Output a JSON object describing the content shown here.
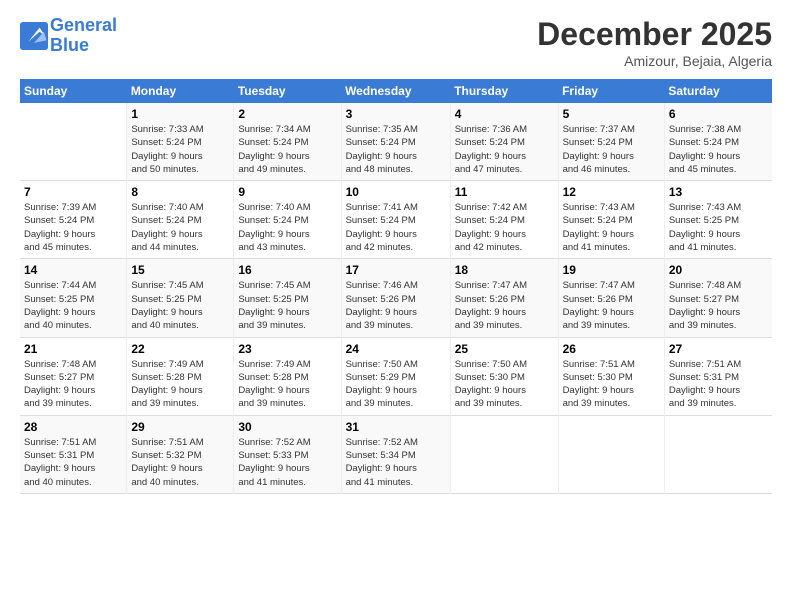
{
  "logo": {
    "line1": "General",
    "line2": "Blue"
  },
  "title": "December 2025",
  "subtitle": "Amizour, Bejaia, Algeria",
  "days_header": [
    "Sunday",
    "Monday",
    "Tuesday",
    "Wednesday",
    "Thursday",
    "Friday",
    "Saturday"
  ],
  "weeks": [
    [
      {
        "day": "",
        "info": ""
      },
      {
        "day": "1",
        "info": "Sunrise: 7:33 AM\nSunset: 5:24 PM\nDaylight: 9 hours\nand 50 minutes."
      },
      {
        "day": "2",
        "info": "Sunrise: 7:34 AM\nSunset: 5:24 PM\nDaylight: 9 hours\nand 49 minutes."
      },
      {
        "day": "3",
        "info": "Sunrise: 7:35 AM\nSunset: 5:24 PM\nDaylight: 9 hours\nand 48 minutes."
      },
      {
        "day": "4",
        "info": "Sunrise: 7:36 AM\nSunset: 5:24 PM\nDaylight: 9 hours\nand 47 minutes."
      },
      {
        "day": "5",
        "info": "Sunrise: 7:37 AM\nSunset: 5:24 PM\nDaylight: 9 hours\nand 46 minutes."
      },
      {
        "day": "6",
        "info": "Sunrise: 7:38 AM\nSunset: 5:24 PM\nDaylight: 9 hours\nand 45 minutes."
      }
    ],
    [
      {
        "day": "7",
        "info": "Sunrise: 7:39 AM\nSunset: 5:24 PM\nDaylight: 9 hours\nand 45 minutes."
      },
      {
        "day": "8",
        "info": "Sunrise: 7:40 AM\nSunset: 5:24 PM\nDaylight: 9 hours\nand 44 minutes."
      },
      {
        "day": "9",
        "info": "Sunrise: 7:40 AM\nSunset: 5:24 PM\nDaylight: 9 hours\nand 43 minutes."
      },
      {
        "day": "10",
        "info": "Sunrise: 7:41 AM\nSunset: 5:24 PM\nDaylight: 9 hours\nand 42 minutes."
      },
      {
        "day": "11",
        "info": "Sunrise: 7:42 AM\nSunset: 5:24 PM\nDaylight: 9 hours\nand 42 minutes."
      },
      {
        "day": "12",
        "info": "Sunrise: 7:43 AM\nSunset: 5:24 PM\nDaylight: 9 hours\nand 41 minutes."
      },
      {
        "day": "13",
        "info": "Sunrise: 7:43 AM\nSunset: 5:25 PM\nDaylight: 9 hours\nand 41 minutes."
      }
    ],
    [
      {
        "day": "14",
        "info": "Sunrise: 7:44 AM\nSunset: 5:25 PM\nDaylight: 9 hours\nand 40 minutes."
      },
      {
        "day": "15",
        "info": "Sunrise: 7:45 AM\nSunset: 5:25 PM\nDaylight: 9 hours\nand 40 minutes."
      },
      {
        "day": "16",
        "info": "Sunrise: 7:45 AM\nSunset: 5:25 PM\nDaylight: 9 hours\nand 39 minutes."
      },
      {
        "day": "17",
        "info": "Sunrise: 7:46 AM\nSunset: 5:26 PM\nDaylight: 9 hours\nand 39 minutes."
      },
      {
        "day": "18",
        "info": "Sunrise: 7:47 AM\nSunset: 5:26 PM\nDaylight: 9 hours\nand 39 minutes."
      },
      {
        "day": "19",
        "info": "Sunrise: 7:47 AM\nSunset: 5:26 PM\nDaylight: 9 hours\nand 39 minutes."
      },
      {
        "day": "20",
        "info": "Sunrise: 7:48 AM\nSunset: 5:27 PM\nDaylight: 9 hours\nand 39 minutes."
      }
    ],
    [
      {
        "day": "21",
        "info": "Sunrise: 7:48 AM\nSunset: 5:27 PM\nDaylight: 9 hours\nand 39 minutes."
      },
      {
        "day": "22",
        "info": "Sunrise: 7:49 AM\nSunset: 5:28 PM\nDaylight: 9 hours\nand 39 minutes."
      },
      {
        "day": "23",
        "info": "Sunrise: 7:49 AM\nSunset: 5:28 PM\nDaylight: 9 hours\nand 39 minutes."
      },
      {
        "day": "24",
        "info": "Sunrise: 7:50 AM\nSunset: 5:29 PM\nDaylight: 9 hours\nand 39 minutes."
      },
      {
        "day": "25",
        "info": "Sunrise: 7:50 AM\nSunset: 5:30 PM\nDaylight: 9 hours\nand 39 minutes."
      },
      {
        "day": "26",
        "info": "Sunrise: 7:51 AM\nSunset: 5:30 PM\nDaylight: 9 hours\nand 39 minutes."
      },
      {
        "day": "27",
        "info": "Sunrise: 7:51 AM\nSunset: 5:31 PM\nDaylight: 9 hours\nand 39 minutes."
      }
    ],
    [
      {
        "day": "28",
        "info": "Sunrise: 7:51 AM\nSunset: 5:31 PM\nDaylight: 9 hours\nand 40 minutes."
      },
      {
        "day": "29",
        "info": "Sunrise: 7:51 AM\nSunset: 5:32 PM\nDaylight: 9 hours\nand 40 minutes."
      },
      {
        "day": "30",
        "info": "Sunrise: 7:52 AM\nSunset: 5:33 PM\nDaylight: 9 hours\nand 41 minutes."
      },
      {
        "day": "31",
        "info": "Sunrise: 7:52 AM\nSunset: 5:34 PM\nDaylight: 9 hours\nand 41 minutes."
      },
      {
        "day": "",
        "info": ""
      },
      {
        "day": "",
        "info": ""
      },
      {
        "day": "",
        "info": ""
      }
    ]
  ]
}
